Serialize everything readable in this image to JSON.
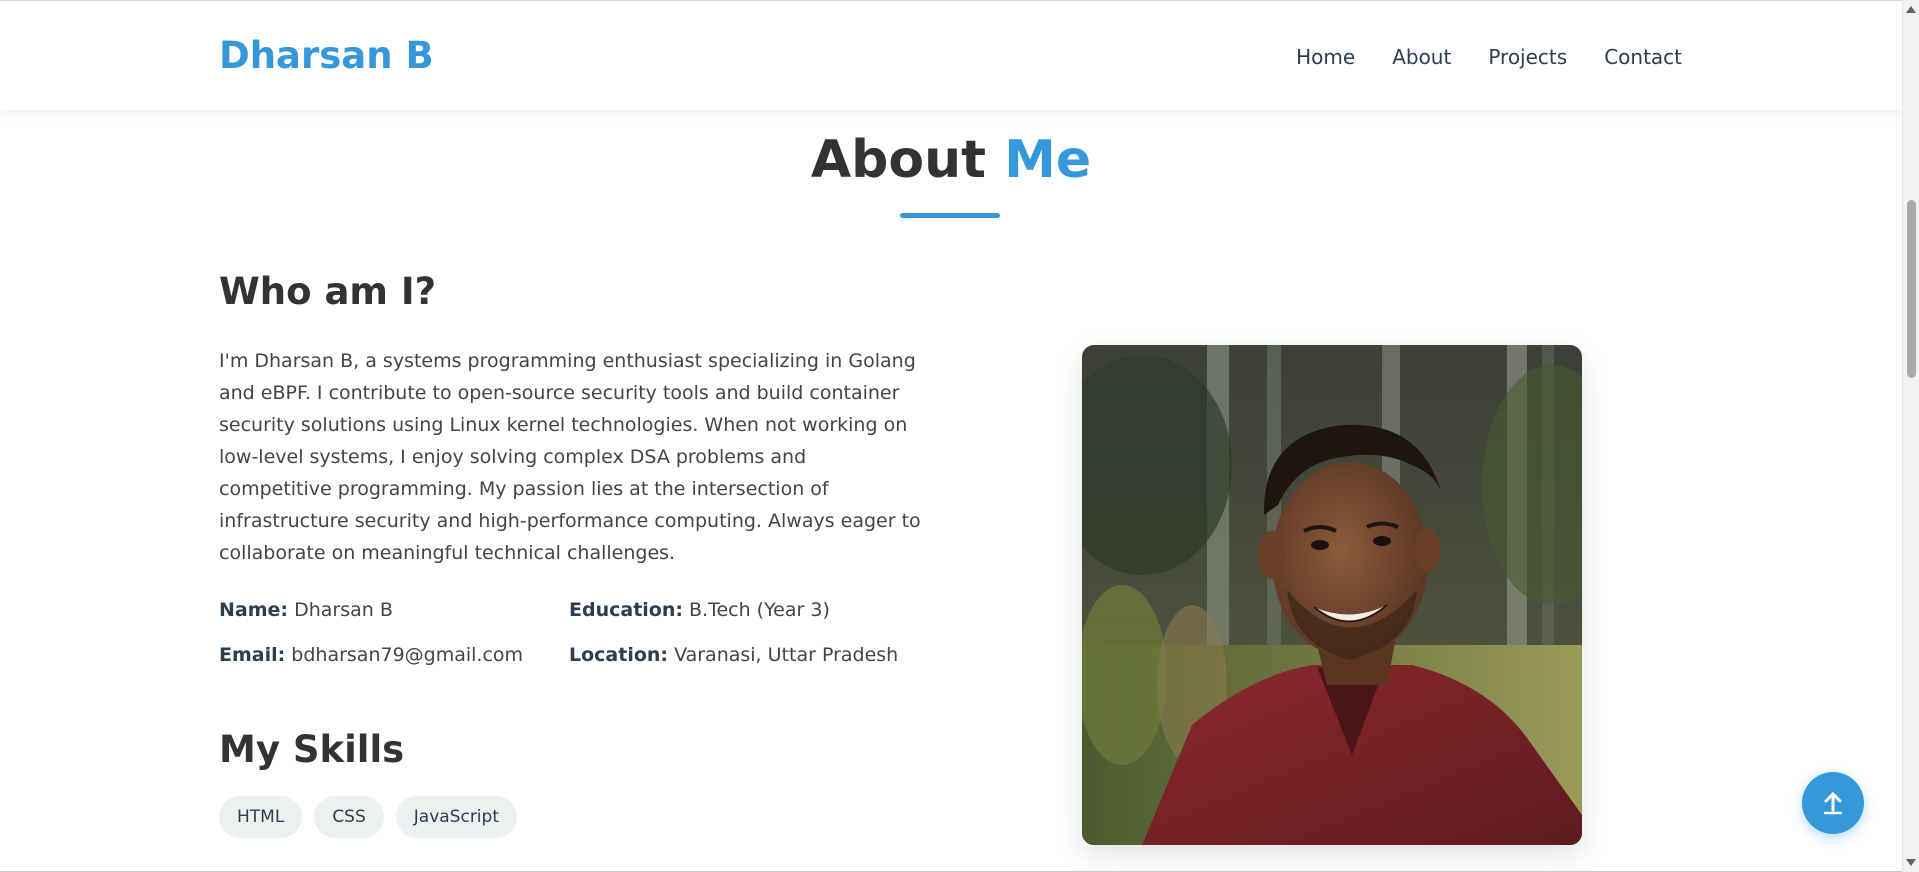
{
  "header": {
    "brand": "Dharsan B",
    "nav": [
      {
        "label": "Home"
      },
      {
        "label": "About"
      },
      {
        "label": "Projects"
      },
      {
        "label": "Contact"
      }
    ]
  },
  "about": {
    "title_main": "About",
    "title_accent": "Me",
    "who_heading": "Who am I?",
    "bio": "I'm Dharsan B, a systems programming enthusiast specializing in Golang and eBPF. I contribute to open-source security tools and build container security solutions using Linux kernel technologies. When not working on low-level systems, I enjoy solving complex DSA problems and competitive programming. My passion lies at the intersection of infrastructure security and high-performance computing. Always eager to collaborate on meaningful technical challenges.",
    "info": {
      "name_label": "Name:",
      "name_value": "Dharsan B",
      "education_label": "Education:",
      "education_value": "B.Tech (Year 3)",
      "email_label": "Email:",
      "email_value": "bdharsan79@gmail.com",
      "location_label": "Location:",
      "location_value": "Varanasi, Uttar Pradesh"
    },
    "skills_heading": "My Skills",
    "skills": [
      "HTML",
      "CSS",
      "JavaScript"
    ]
  },
  "icons": {
    "back_to_top": "arrow-up-icon",
    "scroll_up": "triangle-up-icon",
    "scroll_down": "triangle-down-icon"
  },
  "colors": {
    "accent": "#3498db",
    "heading": "#333333",
    "nav_text": "#2c3e50",
    "skill_tag_bg": "#ecf0f1"
  }
}
